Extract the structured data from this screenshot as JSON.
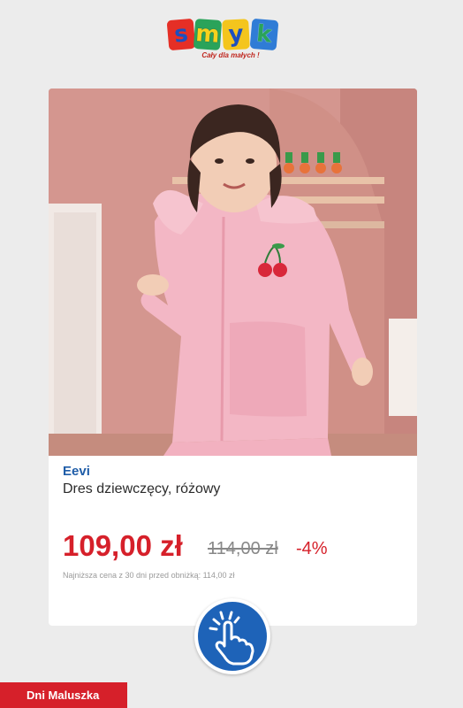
{
  "logo": {
    "letters": [
      "s",
      "m",
      "y",
      "k"
    ],
    "tagline": "Cały dla małych !"
  },
  "product": {
    "brand": "Eevi",
    "name": "Dres dziewczęcy, różowy",
    "price": "109,00 zł",
    "old_price": "114,00 zł",
    "discount": "-4%",
    "lowest_price_note": "Najniższa cena z 30 dni przed obniżką: 114,00 zł",
    "image_icon": "girl-in-pink-tracksuit-photo"
  },
  "tap_button": {
    "icon": "hand-tap-icon"
  },
  "bottom_tag": {
    "label": "Dni Maluszka"
  },
  "colors": {
    "price_red": "#d6202a",
    "brand_blue": "#1f5da8",
    "button_blue": "#1e63b8",
    "tag_red": "#d6202a"
  }
}
